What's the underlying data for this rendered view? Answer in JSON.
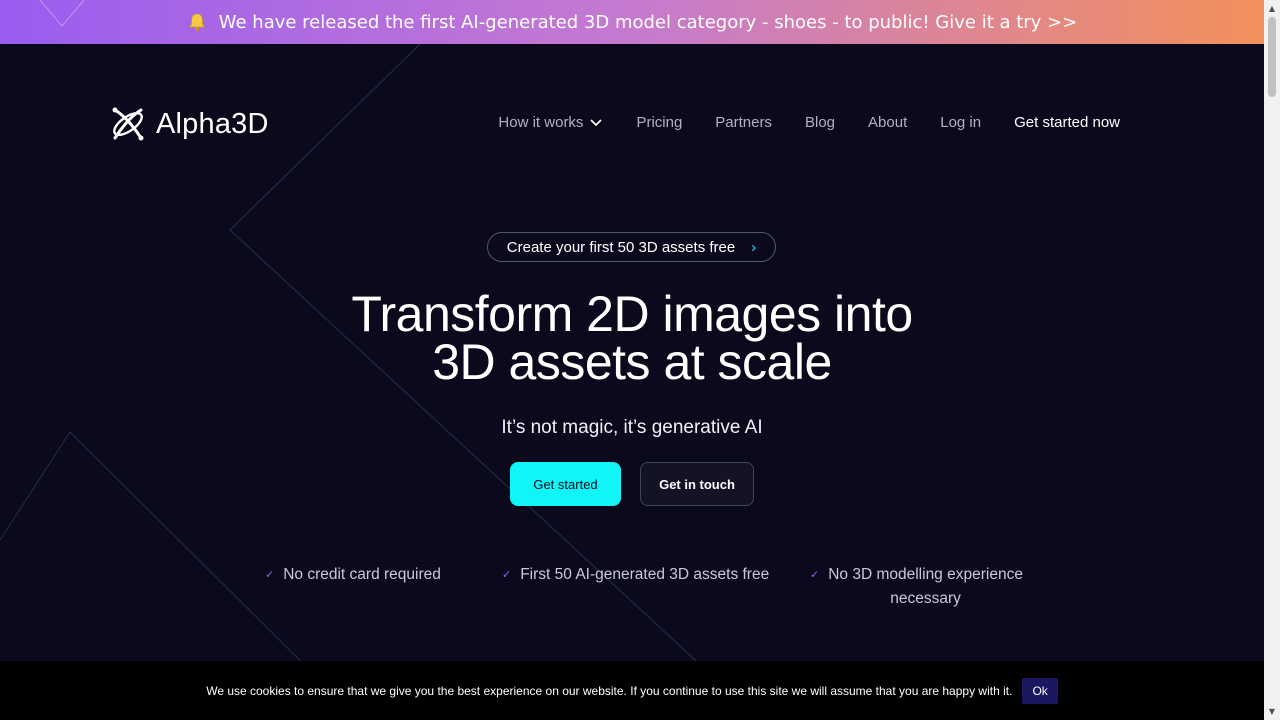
{
  "announcement": {
    "icon": "bell-icon",
    "text": "We have released the first AI-generated 3D model category - shoes - to public! Give it a try >>"
  },
  "logo": {
    "text": "Alpha3D",
    "icon": "atom-x-icon"
  },
  "nav": {
    "items": [
      {
        "label": "How it works",
        "has_dropdown": true
      },
      {
        "label": "Pricing"
      },
      {
        "label": "Partners"
      },
      {
        "label": "Blog"
      },
      {
        "label": "About"
      },
      {
        "label": "Log in"
      }
    ],
    "cta": "Get started now"
  },
  "hero": {
    "pill": "Create your first 50 3D assets free",
    "pill_arrow": "›",
    "title_line1": "Transform 2D images into",
    "title_line2": "3D assets at scale",
    "subtitle": "It’s not magic, it’s generative AI",
    "primary_button": "Get started",
    "secondary_button": "Get in touch",
    "features": [
      {
        "line1": "No credit card required",
        "line2": ""
      },
      {
        "line1": "First 50 AI-generated 3D assets free",
        "line2": ""
      },
      {
        "line1": "No 3D modelling experience",
        "line2": "necessary"
      }
    ],
    "check_glyph": "✓"
  },
  "cookie": {
    "text": "We use cookies to ensure that we give you the best experience on our website. If you continue to use this site we will assume that you are happy with it.",
    "ok": "Ok"
  },
  "colors": {
    "background": "#0b0a1c",
    "accent_cyan": "#10f5f7",
    "gradient_start": "#9a5cf0",
    "gradient_end": "#f4905a",
    "check": "#9a5cf0"
  }
}
